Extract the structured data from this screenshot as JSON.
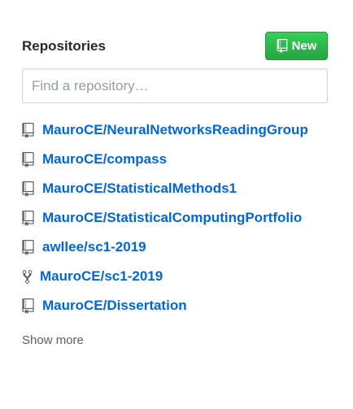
{
  "header": {
    "title": "Repositories",
    "new_button_label": "New"
  },
  "search": {
    "placeholder": "Find a repository…",
    "value": ""
  },
  "repositories": [
    {
      "name": "MauroCE/NeuralNetworksReadingGroup",
      "icon": "repo-icon"
    },
    {
      "name": "MauroCE/compass",
      "icon": "repo-icon"
    },
    {
      "name": "MauroCE/StatisticalMethods1",
      "icon": "repo-icon"
    },
    {
      "name": "MauroCE/StatisticalComputingPortfolio",
      "icon": "repo-icon"
    },
    {
      "name": "awllee/sc1-2019",
      "icon": "repo-icon"
    },
    {
      "name": "MauroCE/sc1-2019",
      "icon": "repo-forked-icon"
    },
    {
      "name": "MauroCE/Dissertation",
      "icon": "repo-icon"
    }
  ],
  "show_more_label": "Show more",
  "colors": {
    "link": "#0366d6",
    "new_button": "#28a745",
    "muted_text": "#586069",
    "icon": "#586069"
  }
}
